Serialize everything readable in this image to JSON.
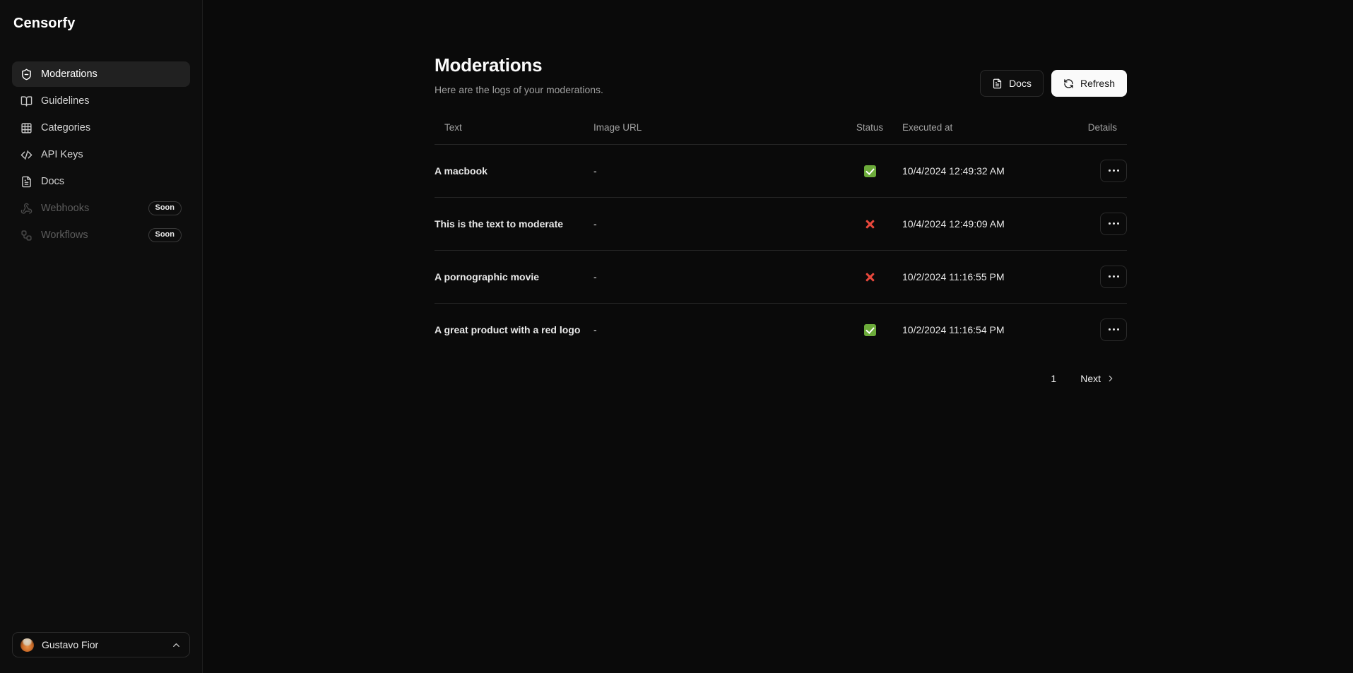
{
  "brand": {
    "name": "Censorfy"
  },
  "sidebar": {
    "items": [
      {
        "label": "Moderations",
        "icon": "shield-minus-icon",
        "active": true,
        "badge": null
      },
      {
        "label": "Guidelines",
        "icon": "book-open-icon",
        "active": false,
        "badge": null
      },
      {
        "label": "Categories",
        "icon": "grid-icon",
        "active": false,
        "badge": null
      },
      {
        "label": "API Keys",
        "icon": "code-icon",
        "active": false,
        "badge": null
      },
      {
        "label": "Docs",
        "icon": "file-text-icon",
        "active": false,
        "badge": null
      },
      {
        "label": "Webhooks",
        "icon": "webhook-icon",
        "active": false,
        "badge": "Soon"
      },
      {
        "label": "Workflows",
        "icon": "workflow-icon",
        "active": false,
        "badge": "Soon"
      }
    ],
    "user": {
      "name": "Gustavo Fior",
      "chevron": "chevron-up-icon"
    }
  },
  "header": {
    "title": "Moderations",
    "subtitle": "Here are the logs of your moderations.",
    "docs_label": "Docs",
    "refresh_label": "Refresh"
  },
  "table": {
    "columns": [
      "Text",
      "Image URL",
      "Status",
      "Executed at",
      "Details"
    ],
    "rows": [
      {
        "text": "A macbook",
        "image_url": "-",
        "status": "approved",
        "executed_at": "10/4/2024 12:49:32 AM"
      },
      {
        "text": "This is the text to moderate",
        "image_url": "-",
        "status": "rejected",
        "executed_at": "10/4/2024 12:49:09 AM"
      },
      {
        "text": "A pornographic movie",
        "image_url": "-",
        "status": "rejected",
        "executed_at": "10/2/2024 11:16:55 PM"
      },
      {
        "text": "A great product with a red logo",
        "image_url": "-",
        "status": "approved",
        "executed_at": "10/2/2024 11:16:54 PM"
      }
    ]
  },
  "pagination": {
    "current_page": "1",
    "next_label": "Next"
  },
  "colors": {
    "background": "#0a0a0a",
    "sidebar": "#0d0d0d",
    "active_item": "#212121",
    "border": "#262626",
    "status_approved": "#6cab3a",
    "status_rejected": "#e8483c",
    "primary_button": "#fafafa"
  }
}
